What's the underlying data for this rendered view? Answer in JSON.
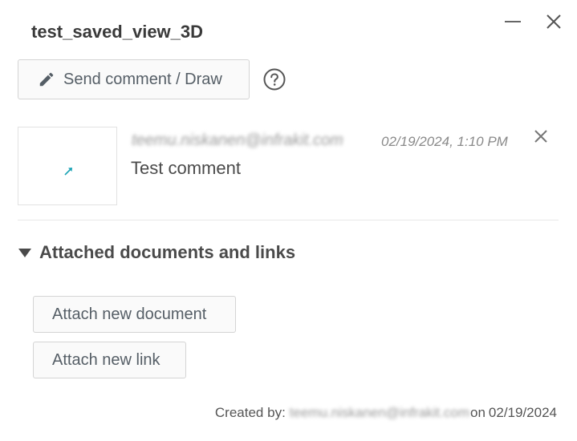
{
  "dialog": {
    "title": "test_saved_view_3D"
  },
  "toolbar": {
    "send_comment_label": "Send comment / Draw"
  },
  "comment": {
    "author": "teemu.niskanen@infrakit.com",
    "timestamp": "02/19/2024, 1:10 PM",
    "text": "Test comment"
  },
  "attachments": {
    "section_title": "Attached documents and links",
    "attach_document_label": "Attach new document",
    "attach_link_label": "Attach new link"
  },
  "footer": {
    "created_by_label": "Created by:",
    "creator": "teemu.niskanen@infrakit.com",
    "on_label": "on",
    "created_date": "02/19/2024"
  },
  "colors": {
    "button_text": "#555e66",
    "accent_arrow": "#1aa3b5"
  }
}
